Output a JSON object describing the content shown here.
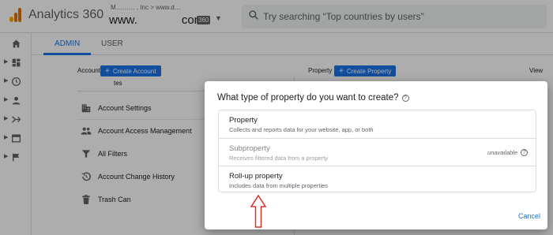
{
  "header": {
    "app_title": "Analytics 360",
    "account_path": "M……… , Inc > www.d…",
    "property_name_prefix": "www.",
    "property_name_suffix": "com",
    "badge": "360",
    "search_placeholder": "Try searching “Top countries by users”"
  },
  "tabs": [
    {
      "label": "ADMIN",
      "active": true
    },
    {
      "label": "USER",
      "active": false
    }
  ],
  "account": {
    "label": "Account",
    "create_button": "Create Account",
    "selected": "tes",
    "menu": [
      {
        "label": "Account Settings",
        "icon": "building-icon"
      },
      {
        "label": "Account Access Management",
        "icon": "people-icon"
      },
      {
        "label": "All Filters",
        "icon": "filter-icon"
      },
      {
        "label": "Account Change History",
        "icon": "history-icon"
      },
      {
        "label": "Trash Can",
        "icon": "trash-icon"
      }
    ]
  },
  "property": {
    "label": "Property",
    "create_button": "Create Property"
  },
  "view": {
    "label": "View"
  },
  "dialog": {
    "title": "What type of property do you want to create?",
    "options": [
      {
        "title": "Property",
        "description": "Collects and reports data for your website, app, or both",
        "enabled": true
      },
      {
        "title": "Subproperty",
        "description": "Receives filtered data from a property",
        "enabled": false,
        "status": "unavailable"
      },
      {
        "title": "Roll-up property",
        "description": "Includes data from multiple properties",
        "enabled": true
      }
    ],
    "cancel_label": "Cancel"
  },
  "colors": {
    "accent": "#1a73e8",
    "annotation_arrow": "#d93025",
    "scrim": "rgba(0,0,0,0.32)"
  }
}
